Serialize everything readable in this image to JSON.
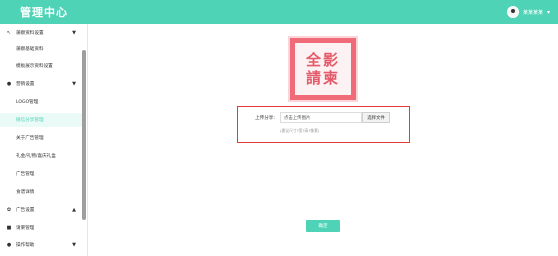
{
  "header": {
    "title": "管理中心",
    "user_name": "某某某某",
    "user_menu_icon": "caret-down-icon"
  },
  "sidebar": {
    "items": [
      {
        "label": "蒲察资料设置",
        "icon": "cursor-icon",
        "arrow": "▼"
      },
      {
        "label": "蒲察基础资料"
      },
      {
        "label": "模板展示资料设置"
      },
      {
        "label": "营销设置",
        "icon": "dot-icon",
        "arrow": "▼"
      },
      {
        "label": "LOGO管理"
      },
      {
        "label": "微信分享管理"
      },
      {
        "label": "关于广告管理"
      },
      {
        "label": "礼金/礼物/喜庆礼盒"
      },
      {
        "label": "广告管理"
      },
      {
        "label": "食谱详情"
      },
      {
        "label": "广告设置",
        "icon": "gear-icon",
        "arrow": "▲"
      },
      {
        "label": "请柬管理",
        "icon": "square-icon"
      },
      {
        "label": "操作帮助",
        "icon": "question-icon",
        "arrow": "▼"
      }
    ]
  },
  "main": {
    "preview_text": "全影請柬",
    "upload_label": "上传分享:",
    "file_value": "点击上传图片",
    "file_button": "选择文件",
    "hint": "(建议尺寸?宽?高?像素)",
    "confirm_button": "确定"
  },
  "colors": {
    "accent": "#4fd3b6",
    "highlight_border": "#e53935",
    "preview_bg": "#f06b78"
  }
}
